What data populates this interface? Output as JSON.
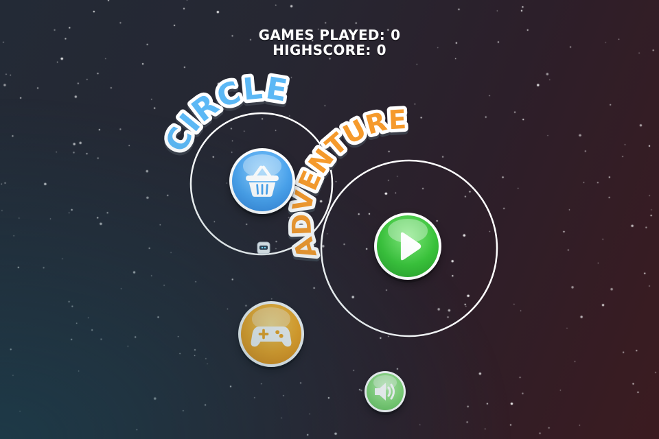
{
  "stats": {
    "games_played_label": "GAMES PLAYED:",
    "games_played_value": "0",
    "highscore_label": "HIGHSCORE:",
    "highscore_value": "0"
  },
  "title": {
    "word1": "CIRCLE",
    "word2": "ADVENTURE",
    "word1_color": "#5cb8f5",
    "word2_color": "#f59a2c"
  },
  "buttons": {
    "shop": {
      "icon": "basket-icon",
      "color": "#4aa3ee"
    },
    "play": {
      "icon": "play-icon",
      "color": "#39c23a"
    },
    "more_games": {
      "icon": "gamepad-icon",
      "color": "#f7a922"
    },
    "sound": {
      "icon": "speaker-icon",
      "color": "#86d97a"
    }
  },
  "player": {
    "icon": "robot-icon"
  },
  "colors": {
    "background_left": "#232a36",
    "background_right": "#3b1b20",
    "orbit": "#ffffff"
  }
}
